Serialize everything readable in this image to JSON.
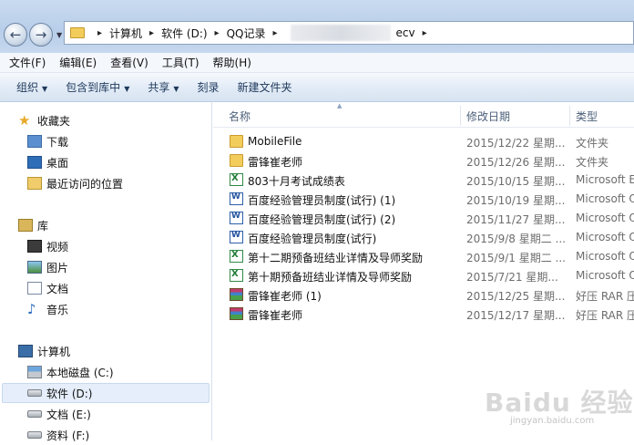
{
  "address": {
    "crumbs": [
      "计算机",
      "软件 (D:)",
      "QQ记录",
      "ecv"
    ]
  },
  "menu": [
    "文件(F)",
    "编辑(E)",
    "查看(V)",
    "工具(T)",
    "帮助(H)"
  ],
  "toolbar": {
    "organize": "组织",
    "include_library": "包含到库中",
    "share": "共享",
    "burn": "刻录",
    "new_folder": "新建文件夹"
  },
  "nav": {
    "favorites": {
      "title": "收藏夹",
      "items": [
        "下载",
        "桌面",
        "最近访问的位置"
      ]
    },
    "libraries": {
      "title": "库",
      "items": [
        "视频",
        "图片",
        "文档",
        "音乐"
      ]
    },
    "computer": {
      "title": "计算机",
      "items": [
        "本地磁盘 (C:)",
        "软件 (D:)",
        "文档 (E:)",
        "资料 (F:)"
      ]
    }
  },
  "columns": {
    "name": "名称",
    "date": "修改日期",
    "type": "类型"
  },
  "files": [
    {
      "name": "MobileFile",
      "date": "2015/12/22 星期...",
      "type": "文件夹",
      "icon": "folder-icon"
    },
    {
      "name": "雷锋崔老师",
      "date": "2015/12/26 星期...",
      "type": "文件夹",
      "icon": "folder-icon"
    },
    {
      "name": "803十月考试成绩表",
      "date": "2015/10/15 星期...",
      "type": "Microsoft E",
      "icon": "excel-file-icon"
    },
    {
      "name": "百度经验管理员制度(试行) (1)",
      "date": "2015/10/19 星期...",
      "type": "Microsoft O",
      "icon": "word-file-icon"
    },
    {
      "name": "百度经验管理员制度(试行) (2)",
      "date": "2015/11/27 星期...",
      "type": "Microsoft O",
      "icon": "word-file-icon"
    },
    {
      "name": "百度经验管理员制度(试行)",
      "date": "2015/9/8 星期二 ...",
      "type": "Microsoft O",
      "icon": "word-file-icon"
    },
    {
      "name": "第十二期预备班结业详情及导师奖励",
      "date": "2015/9/1 星期二 ...",
      "type": "Microsoft O",
      "icon": "excel-file-icon"
    },
    {
      "name": "第十期预备班结业详情及导师奖励",
      "date": "2015/7/21 星期...",
      "type": "Microsoft O",
      "icon": "excel-file-icon"
    },
    {
      "name": "雷锋崔老师 (1)",
      "date": "2015/12/25 星期...",
      "type": "好压 RAR 压",
      "icon": "rar-archive-icon"
    },
    {
      "name": "雷锋崔老师",
      "date": "2015/12/17 星期...",
      "type": "好压 RAR 压",
      "icon": "rar-archive-icon"
    }
  ],
  "watermark": {
    "text": "Baidu 经验",
    "url": "jingyan.baidu.com"
  }
}
